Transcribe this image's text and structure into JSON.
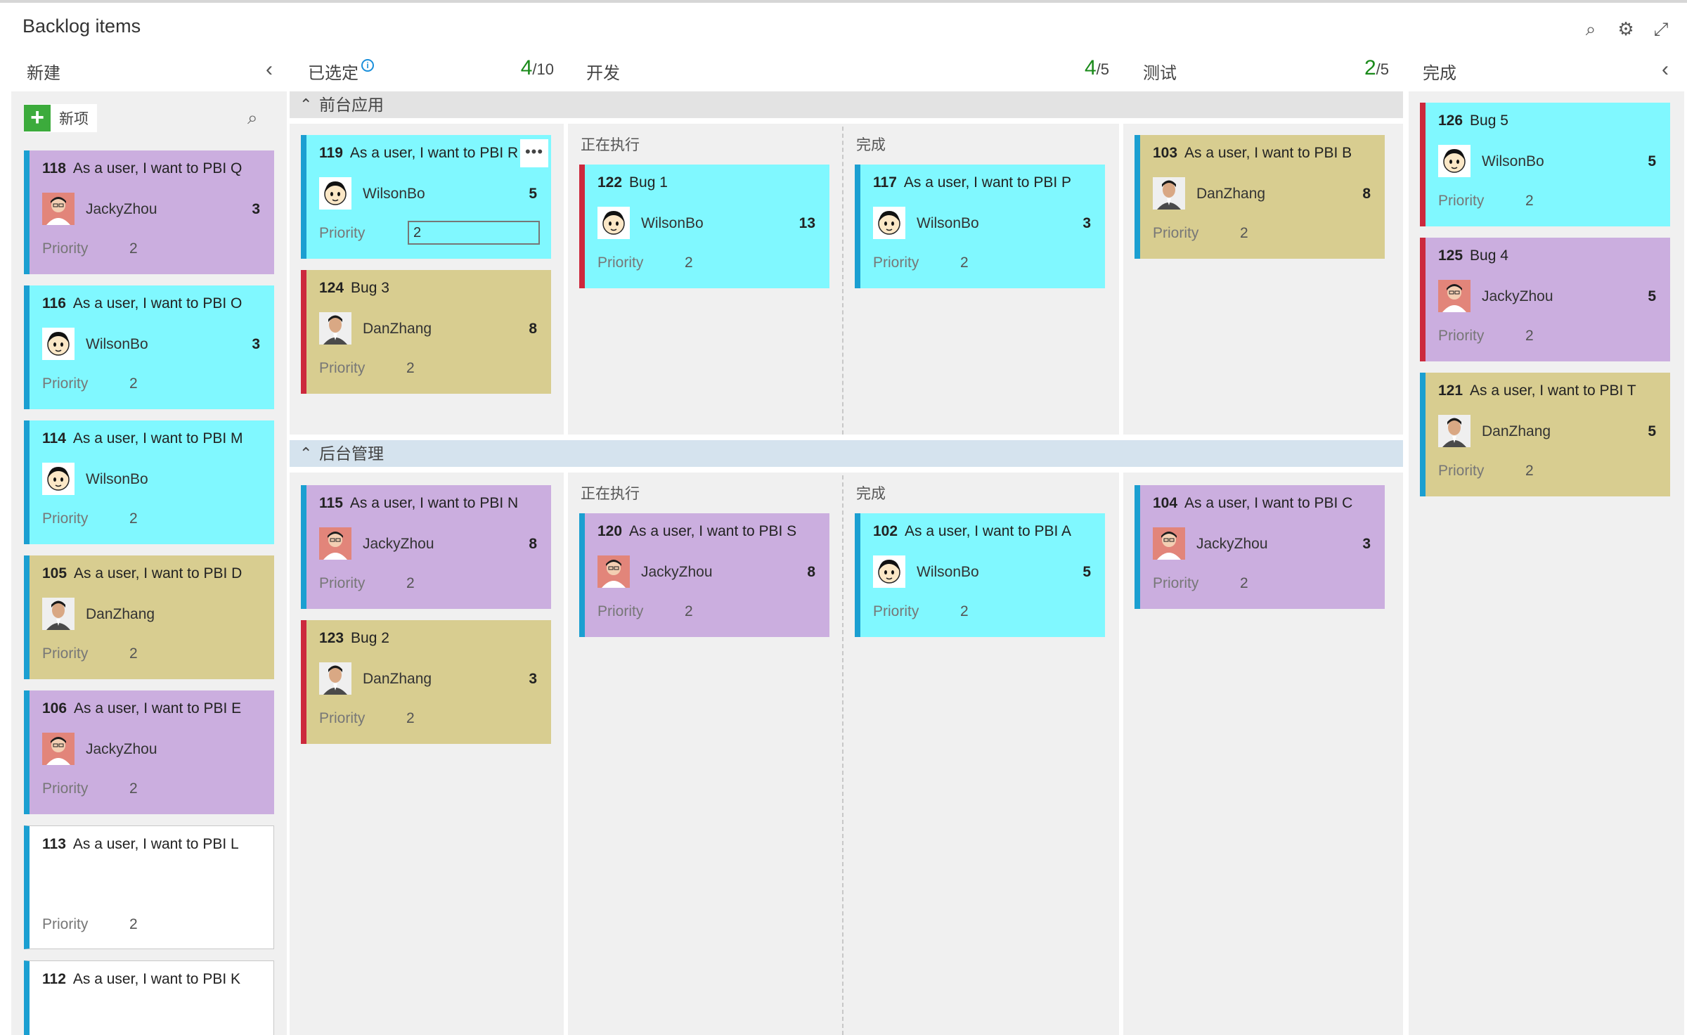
{
  "page": {
    "title": "Backlog items"
  },
  "toolbar": {
    "search_icon": "search-icon",
    "settings_icon": "gear-icon",
    "fullscreen_icon": "fullscreen-icon"
  },
  "columns": {
    "new": {
      "name": "新建",
      "new_item_label": "新项"
    },
    "selected": {
      "name": "已选定",
      "count": "4",
      "limit": "/10"
    },
    "dev": {
      "name": "开发",
      "count": "4",
      "limit": "/5"
    },
    "test": {
      "name": "测试",
      "count": "2",
      "limit": "/5"
    },
    "done": {
      "name": "完成"
    }
  },
  "subcolumns": {
    "doing": "正在执行",
    "done": "完成"
  },
  "swimlanes": {
    "frontend": "前台应用",
    "backend": "后台管理"
  },
  "priority_label": "Priority",
  "colors": {
    "cyan": "#80f8ff",
    "purple": "#cbaedf",
    "tan": "#d8cd90",
    "pbi_bar": "#1b9fd1",
    "bug_bar": "#cc293d",
    "count_green": "#1a8a1a"
  },
  "cards": {
    "new": [
      {
        "id": "118",
        "title": "As a user, I want to PBI Q",
        "assignee": "JackyZhou",
        "effort": "3",
        "priority": "2"
      },
      {
        "id": "116",
        "title": "As a user, I want to PBI O",
        "assignee": "WilsonBo",
        "effort": "3",
        "priority": "2"
      },
      {
        "id": "114",
        "title": "As a user, I want to PBI M",
        "assignee": "WilsonBo",
        "effort": "",
        "priority": "2"
      },
      {
        "id": "105",
        "title": "As a user, I want to PBI D",
        "assignee": "DanZhang",
        "effort": "",
        "priority": "2"
      },
      {
        "id": "106",
        "title": "As a user, I want to PBI E",
        "assignee": "JackyZhou",
        "effort": "",
        "priority": "2"
      },
      {
        "id": "113",
        "title": "As a user, I want to PBI L",
        "assignee": "",
        "effort": "",
        "priority": "2"
      },
      {
        "id": "112",
        "title": "As a user, I want to PBI K",
        "assignee": "",
        "effort": "",
        "priority": ""
      }
    ],
    "sel_front": [
      {
        "id": "119",
        "title": "As a user, I want to PBI R",
        "assignee": "WilsonBo",
        "effort": "5",
        "priority": "2",
        "more": "•••"
      },
      {
        "id": "124",
        "title": "Bug 3",
        "assignee": "DanZhang",
        "effort": "8",
        "priority": "2"
      }
    ],
    "dev_doing_front": [
      {
        "id": "122",
        "title": "Bug 1",
        "assignee": "WilsonBo",
        "effort": "13",
        "priority": "2"
      }
    ],
    "dev_done_front": [
      {
        "id": "117",
        "title": "As a user, I want to PBI P",
        "assignee": "WilsonBo",
        "effort": "3",
        "priority": "2"
      }
    ],
    "test_front": [
      {
        "id": "103",
        "title": "As a user, I want to PBI B",
        "assignee": "DanZhang",
        "effort": "8",
        "priority": "2"
      }
    ],
    "sel_back": [
      {
        "id": "115",
        "title": "As a user, I want to PBI N",
        "assignee": "JackyZhou",
        "effort": "8",
        "priority": "2"
      },
      {
        "id": "123",
        "title": "Bug 2",
        "assignee": "DanZhang",
        "effort": "3",
        "priority": "2"
      }
    ],
    "dev_doing_back": [
      {
        "id": "120",
        "title": "As a user, I want to PBI S",
        "assignee": "JackyZhou",
        "effort": "8",
        "priority": "2"
      }
    ],
    "dev_done_back": [
      {
        "id": "102",
        "title": "As a user, I want to PBI A",
        "assignee": "WilsonBo",
        "effort": "5",
        "priority": "2"
      }
    ],
    "test_back": [
      {
        "id": "104",
        "title": "As a user, I want to PBI C",
        "assignee": "JackyZhou",
        "effort": "3",
        "priority": "2"
      }
    ],
    "done": [
      {
        "id": "126",
        "title": "Bug 5",
        "assignee": "WilsonBo",
        "effort": "5",
        "priority": "2"
      },
      {
        "id": "125",
        "title": "Bug 4",
        "assignee": "JackyZhou",
        "effort": "5",
        "priority": "2"
      },
      {
        "id": "121",
        "title": "As a user, I want to PBI T",
        "assignee": "DanZhang",
        "effort": "5",
        "priority": "2"
      }
    ]
  }
}
